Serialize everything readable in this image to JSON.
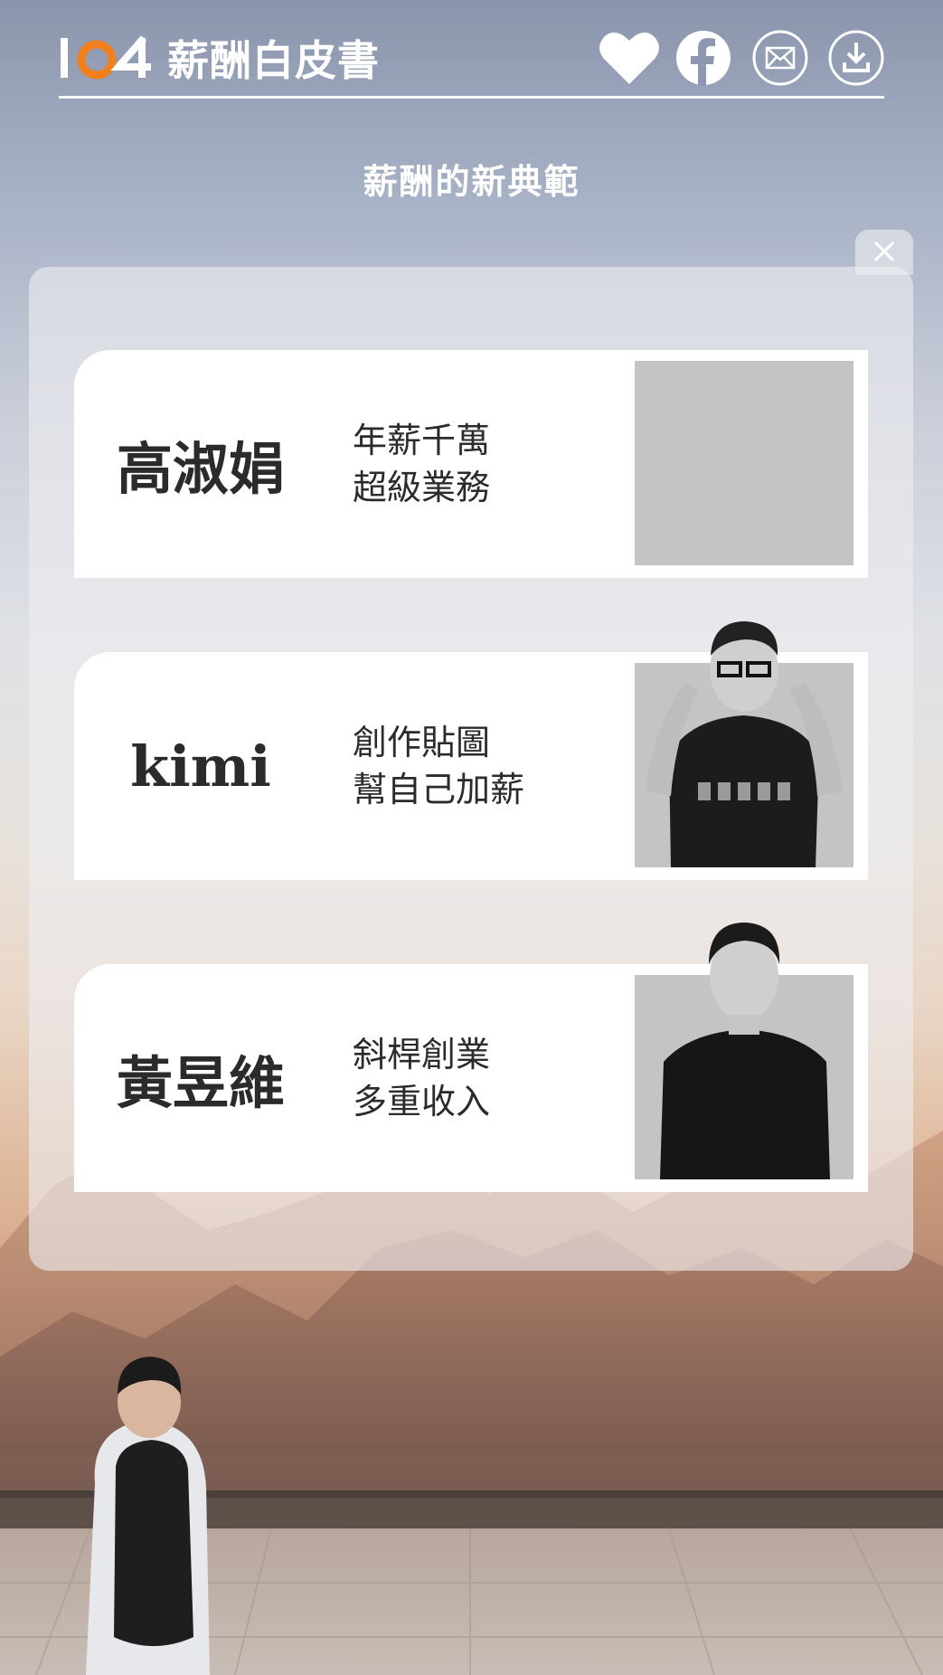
{
  "header": {
    "logo_number": "104",
    "logo_title": "薪酬白皮書",
    "icons": [
      "heart-icon",
      "facebook-icon",
      "mail-icon",
      "download-icon"
    ]
  },
  "page": {
    "heading": "薪酬的新典範"
  },
  "cards": [
    {
      "name": "高淑娟",
      "desc_line1": "年薪千萬",
      "desc_line2": "超級業務"
    },
    {
      "name": "kimi",
      "desc_line1": "創作貼圖",
      "desc_line2": "幫自己加薪"
    },
    {
      "name": "黃昱維",
      "desc_line1": "斜桿創業",
      "desc_line2": "多重收入"
    }
  ],
  "colors": {
    "accent_orange": "#f07f1c",
    "card_bg": "#ffffff",
    "photo_bg": "#c4c4c4",
    "text_dark": "#2b2b2b"
  }
}
